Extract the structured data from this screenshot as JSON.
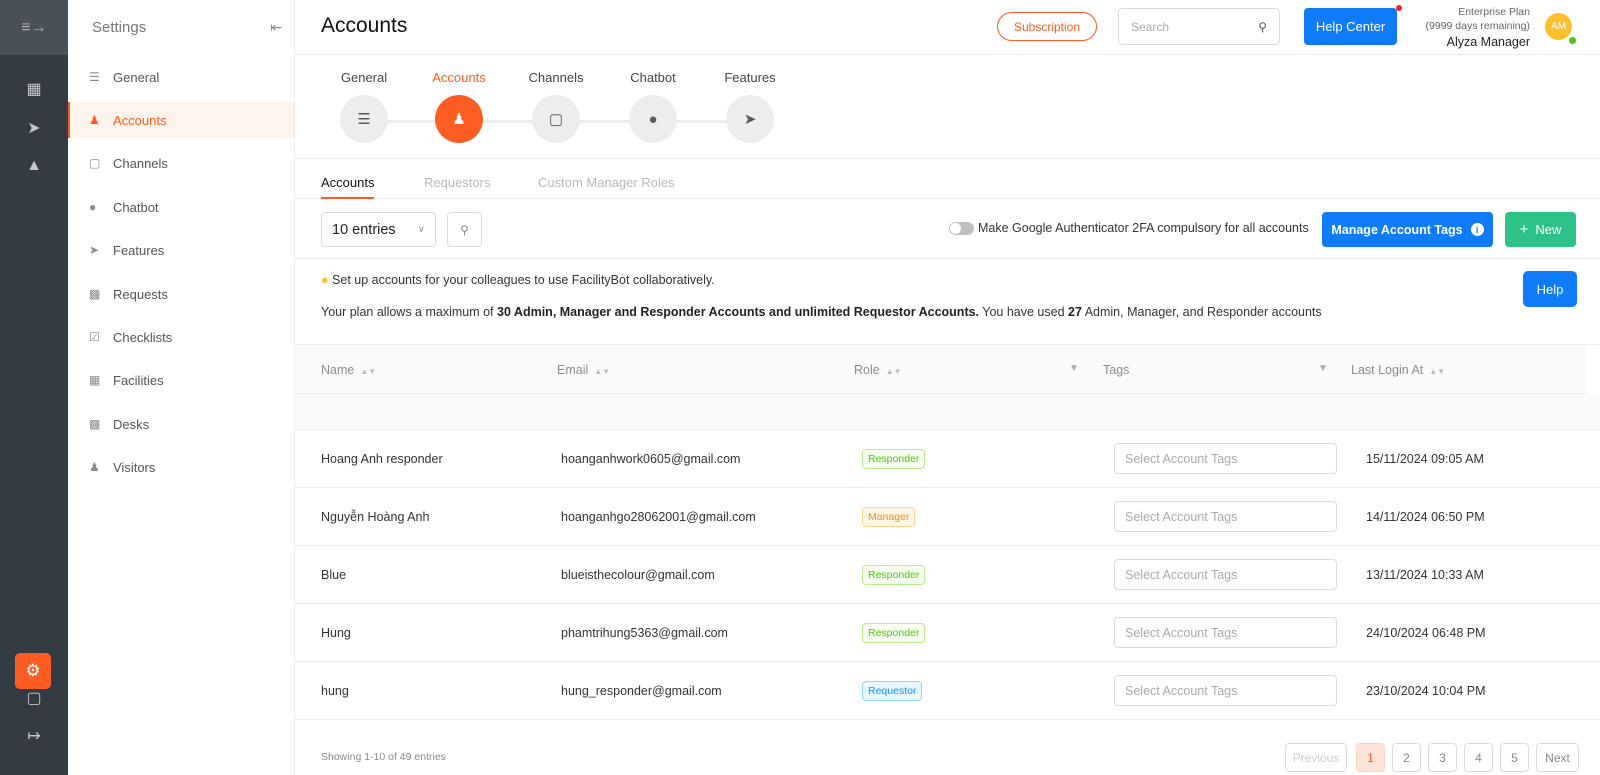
{
  "rail": {
    "menu_icon": "menu-fold-icon"
  },
  "sidebar": {
    "title": "Settings",
    "collapse_icon": "collapse-icon",
    "items": [
      {
        "label": "General",
        "icon": "sliders-icon"
      },
      {
        "label": "Accounts",
        "icon": "user-group-icon"
      },
      {
        "label": "Channels",
        "icon": "cube-icon"
      },
      {
        "label": "Chatbot",
        "icon": "chat-icon"
      },
      {
        "label": "Features",
        "icon": "rocket-icon"
      },
      {
        "label": "Requests",
        "icon": "question-icon"
      },
      {
        "label": "Checklists",
        "icon": "checklist-icon"
      },
      {
        "label": "Facilities",
        "icon": "calendar-icon"
      },
      {
        "label": "Desks",
        "icon": "desk-icon"
      },
      {
        "label": "Visitors",
        "icon": "visitor-icon"
      }
    ],
    "active_index": 1
  },
  "header": {
    "title": "Accounts",
    "subscription_label": "Subscription",
    "search_placeholder": "Search",
    "help_center_label": "Help Center",
    "plan_name": "Enterprise Plan",
    "plan_remaining": "(9999 days remaining)",
    "user_name": "Alyza Manager",
    "avatar_initials": "AM"
  },
  "steps": [
    {
      "label": "General"
    },
    {
      "label": "Accounts"
    },
    {
      "label": "Channels"
    },
    {
      "label": "Chatbot"
    },
    {
      "label": "Features"
    }
  ],
  "subtabs": [
    "Accounts",
    "Requestors",
    "Custom Manager Roles"
  ],
  "controls": {
    "entries_label": "10 entries",
    "twofa_label": "Make Google Authenticator 2FA compulsory for all accounts",
    "twofa_enabled": false,
    "manage_tags_label": "Manage Account Tags",
    "new_label": "New"
  },
  "info": {
    "tip": "Set up accounts for your colleagues to use FacilityBot collaboratively.",
    "plan_prefix": "Your plan allows a maximum of ",
    "plan_bold": "30 Admin, Manager and Responder Accounts and unlimited Requestor Accounts.",
    "plan_mid": " You have used ",
    "plan_used": "27",
    "plan_suffix": " Admin, Manager, and Responder accounts",
    "help_label": "Help"
  },
  "table": {
    "columns": [
      "Name",
      "Email",
      "Role",
      "Tags",
      "Last Login At"
    ],
    "tag_placeholder": "Select Account Tags",
    "rows": [
      {
        "name": "Hoang Anh responder",
        "email": "hoanganhwork0605@gmail.com",
        "role": "Responder",
        "last_login": "15/11/2024 09:05 AM"
      },
      {
        "name": "Nguyễn Hoàng Anh",
        "email": "hoanganhgo28062001@gmail.com",
        "role": "Manager",
        "last_login": "14/11/2024 06:50 PM"
      },
      {
        "name": "Blue",
        "email": "blueisthecolour@gmail.com",
        "role": "Responder",
        "last_login": "13/11/2024 10:33 AM"
      },
      {
        "name": "Hung",
        "email": "phamtrihung5363@gmail.com",
        "role": "Responder",
        "last_login": "24/10/2024 06:48 PM"
      },
      {
        "name": "hung",
        "email": "hung_responder@gmail.com",
        "role": "Requestor",
        "last_login": "23/10/2024 10:04 PM"
      }
    ]
  },
  "footer": {
    "showing": "Showing 1-10 of 49 entries",
    "previous": "Previous",
    "pages": [
      "1",
      "2",
      "3",
      "4",
      "5"
    ],
    "next": "Next",
    "current_page": "1"
  },
  "colors": {
    "accent": "#fd5c22",
    "primary": "#0f7bf7",
    "success": "#2dc287",
    "rail": "#343b43"
  }
}
